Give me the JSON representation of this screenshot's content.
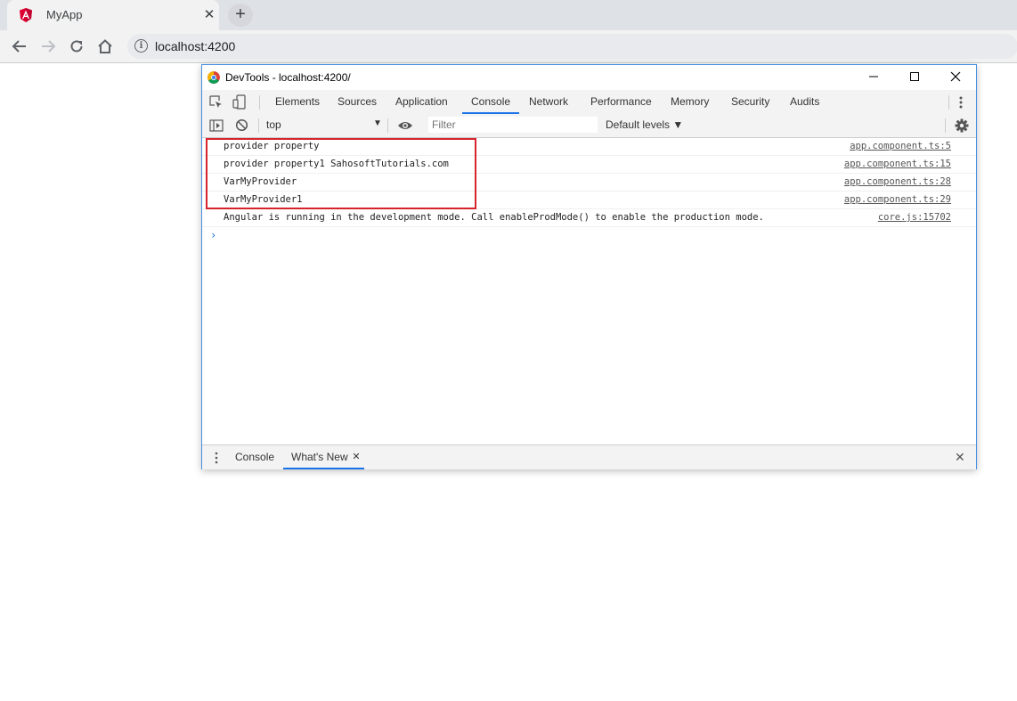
{
  "browser": {
    "tab_title": "MyApp",
    "tab_close": "✕",
    "new_tab": "+",
    "url": "localhost:4200"
  },
  "devtools": {
    "window_title": "DevTools - localhost:4200/",
    "tabs": [
      {
        "label": "Elements"
      },
      {
        "label": "Sources"
      },
      {
        "label": "Application"
      },
      {
        "label": "Console"
      },
      {
        "label": "Network"
      },
      {
        "label": "Performance"
      },
      {
        "label": "Memory"
      },
      {
        "label": "Security"
      },
      {
        "label": "Audits"
      }
    ],
    "active_tab": "Console",
    "console_bar": {
      "context": "top",
      "filter_placeholder": "Filter",
      "levels": "Default levels ▼"
    },
    "logs": [
      {
        "message": "provider property",
        "source": "app.component.ts:5"
      },
      {
        "message": "provider property1 SahosoftTutorials.com",
        "source": "app.component.ts:15"
      },
      {
        "message": "VarMyProvider",
        "source": "app.component.ts:28"
      },
      {
        "message": "VarMyProvider1",
        "source": "app.component.ts:29"
      },
      {
        "message": "Angular is running in the development mode. Call enableProdMode() to enable the production mode.",
        "source": "core.js:15702"
      }
    ],
    "prompt": "›",
    "drawer": {
      "tabs": [
        {
          "label": "Console"
        },
        {
          "label": "What's New"
        }
      ],
      "close_tab": "✕",
      "close": "✕"
    }
  },
  "colors": {
    "accent": "#1a73e8",
    "highlight": "#d7242c",
    "angular": "#dd0031"
  }
}
